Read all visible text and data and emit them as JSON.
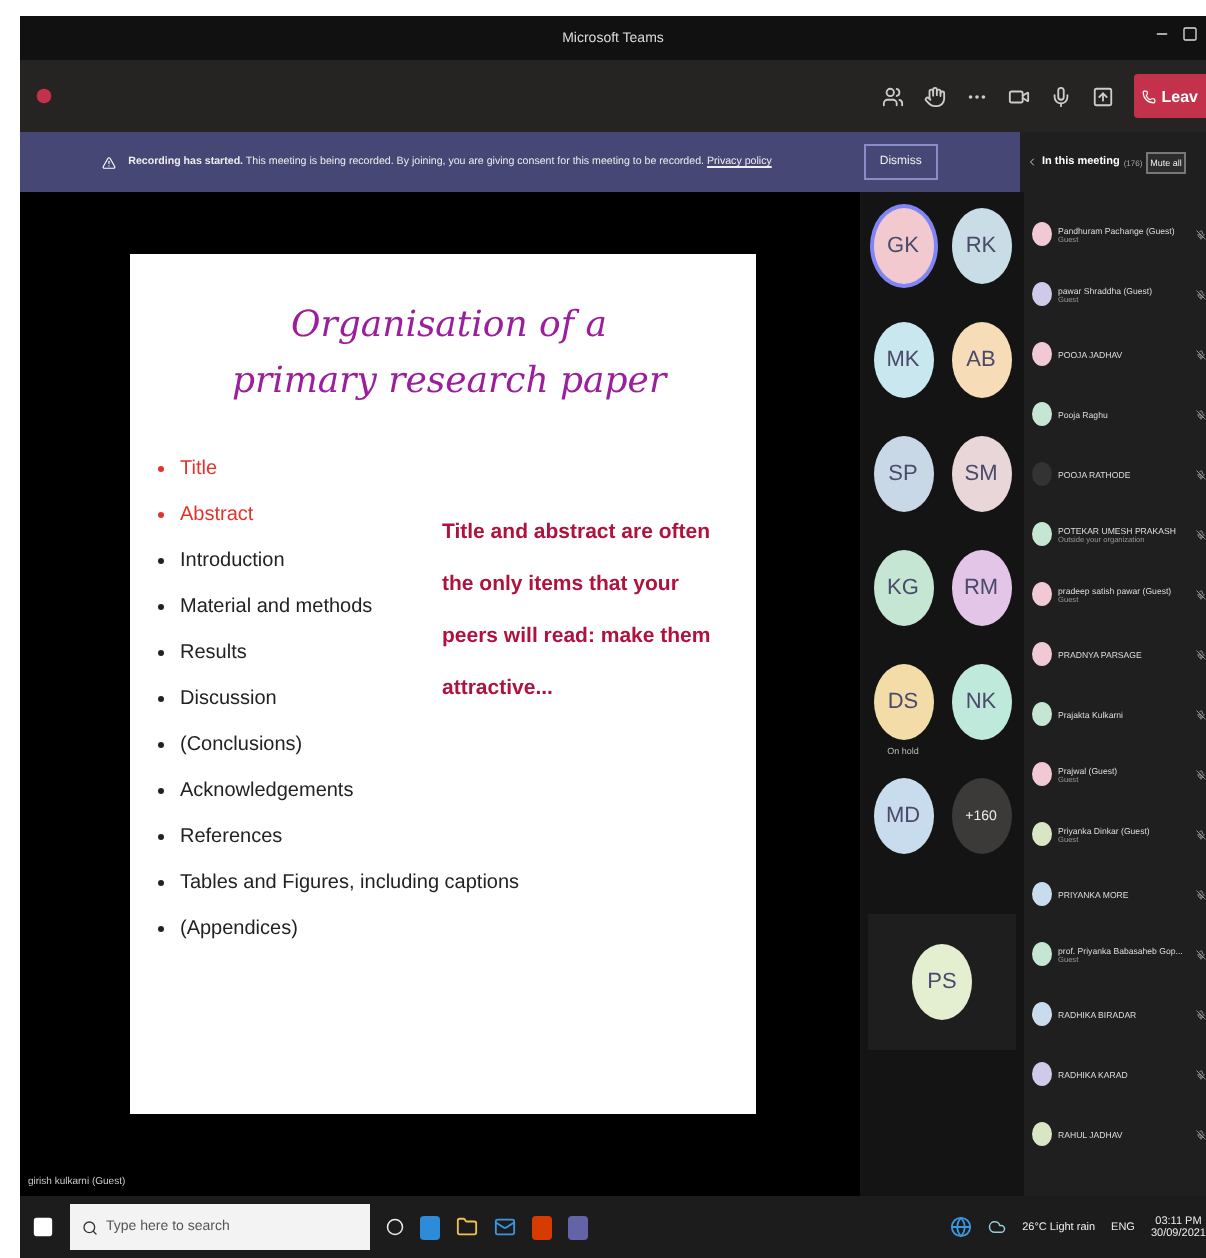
{
  "window": {
    "title": "Microsoft Teams"
  },
  "toolbar": {
    "leave_label": "Leav"
  },
  "banner": {
    "bold": "Recording has started.",
    "text": "This meeting is being recorded. By joining, you are giving consent for this meeting to be recorded.",
    "link": "Privacy policy",
    "dismiss": "Dismiss"
  },
  "slide": {
    "title_lines": [
      "Organisation of a",
      "primary research paper"
    ],
    "bullets": [
      {
        "text": "Title",
        "highlighted": true
      },
      {
        "text": "Abstract",
        "highlighted": true
      },
      {
        "text": "Introduction",
        "highlighted": false
      },
      {
        "text": "Material and methods",
        "highlighted": false
      },
      {
        "text": "Results",
        "highlighted": false
      },
      {
        "text": "Discussion",
        "highlighted": false
      },
      {
        "text": "(Conclusions)",
        "highlighted": false
      },
      {
        "text": "Acknowledgements",
        "highlighted": false
      },
      {
        "text": "References",
        "highlighted": false
      },
      {
        "text": "Tables and Figures, including captions",
        "highlighted": false
      },
      {
        "text": "(Appendices)",
        "highlighted": false
      }
    ],
    "callout": "Title and abstract are often the only items that your peers will read: make them attractive..."
  },
  "presenter_label": "girish kulkarni (Guest)",
  "gallery": {
    "tiles": [
      {
        "initials": "GK",
        "color": "#f3c9d0",
        "speaking": true
      },
      {
        "initials": "RK",
        "color": "#c8dde6",
        "speaking": false
      },
      {
        "initials": "MK",
        "color": "#c9e7ef",
        "speaking": false
      },
      {
        "initials": "AB",
        "color": "#f6dcb7",
        "speaking": false
      },
      {
        "initials": "SP",
        "color": "#c8d8e6",
        "speaking": false
      },
      {
        "initials": "SM",
        "color": "#e8d6d8",
        "speaking": false
      },
      {
        "initials": "KG",
        "color": "#c5e6d2",
        "speaking": false
      },
      {
        "initials": "RM",
        "color": "#e3c5e8",
        "speaking": false
      },
      {
        "initials": "DS",
        "color": "#f4dca8",
        "speaking": false,
        "name": "On hold"
      },
      {
        "initials": "NK",
        "color": "#bfeadb",
        "speaking": false
      },
      {
        "initials": "MD",
        "color": "#c9dcee",
        "speaking": false
      }
    ],
    "overflow": "+160",
    "self_initials": "PS"
  },
  "panel": {
    "title": "In this meeting",
    "count": "(176)",
    "mute_all": "Mute all",
    "participants": [
      {
        "name": "Pandhuram Pachange (Guest)",
        "subtitle": "Guest"
      },
      {
        "name": "pawar Shraddha (Guest)",
        "subtitle": "Guest"
      },
      {
        "name": "POOJA JADHAV"
      },
      {
        "name": "Pooja Raghu"
      },
      {
        "name": "POOJA RATHODE"
      },
      {
        "name": "POTEKAR UMESH PRAKASH",
        "subtitle": "Outside your organization"
      },
      {
        "name": "pradeep satish pawar (Guest)",
        "subtitle": "Guest"
      },
      {
        "name": "PRADNYA PARSAGE"
      },
      {
        "name": "Prajakta Kulkarni"
      },
      {
        "name": "Prajwal (Guest)",
        "subtitle": "Guest"
      },
      {
        "name": "Priyanka Dinkar (Guest)",
        "subtitle": "Guest"
      },
      {
        "name": "PRIYANKA MORE"
      },
      {
        "name": "prof. Priyanka Babasaheb Gop...",
        "subtitle": "Guest"
      },
      {
        "name": "RADHIKA BIRADAR"
      },
      {
        "name": "RADHIKA KARAD"
      },
      {
        "name": "RAHUL JADHAV"
      }
    ]
  },
  "taskbar": {
    "search_placeholder": "Type here to search",
    "weather": "26°C Light rain",
    "language": "ENG",
    "time": "03:11 PM",
    "date": "30/09/2021"
  }
}
